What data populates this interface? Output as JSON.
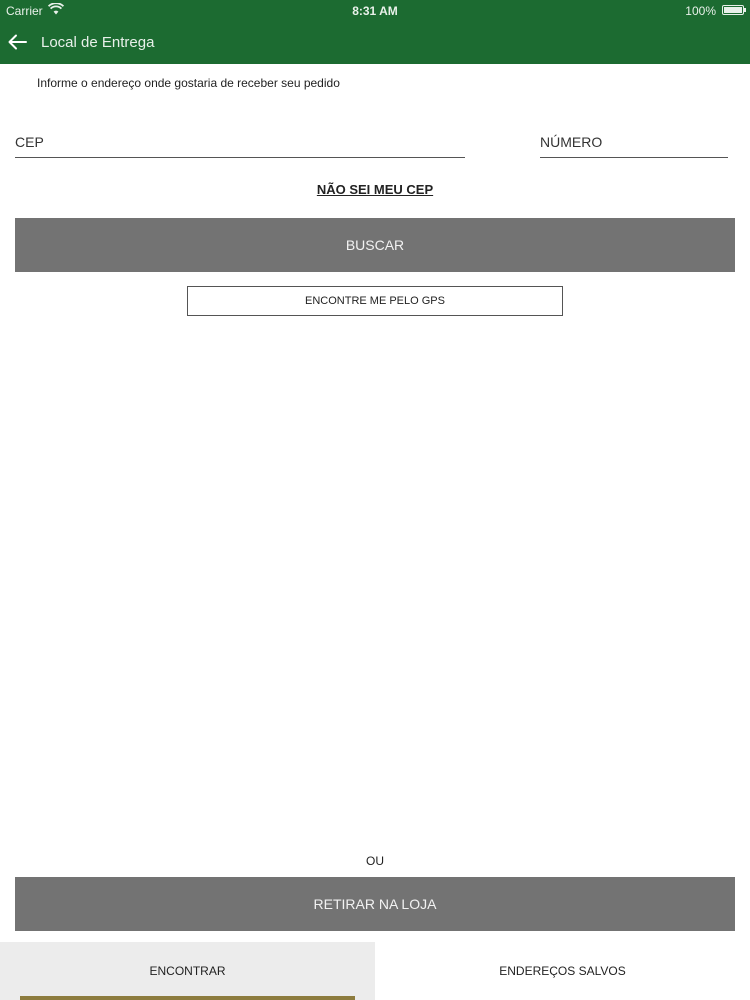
{
  "status_bar": {
    "carrier": "Carrier",
    "time": "8:31 AM",
    "battery": "100%",
    "wifi_icon": "wifi-icon",
    "battery_icon": "battery-icon"
  },
  "header": {
    "title": "Local de Entrega",
    "back_icon": "arrow-left-icon",
    "background_color": "#1c6b31"
  },
  "form": {
    "subtitle": "Informe o endereço onde gostaria de receber seu pedido",
    "cep_placeholder": "CEP",
    "cep_value": "",
    "numero_placeholder": "NÚMERO",
    "numero_value": "",
    "dont_know_cep_label": "NÃO SEI MEU CEP",
    "search_button_label": "BUSCAR",
    "gps_button_label": "ENCONTRE ME PELO GPS",
    "or_label": "OU",
    "pickup_button_label": "RETIRAR NA LOJA",
    "button_color": "#737373"
  },
  "tabs": [
    {
      "label": "ENCONTRAR",
      "active": true
    },
    {
      "label": "ENDEREÇOS SALVOS",
      "active": false
    }
  ],
  "tab_indicator_color": "#8d7c3e"
}
